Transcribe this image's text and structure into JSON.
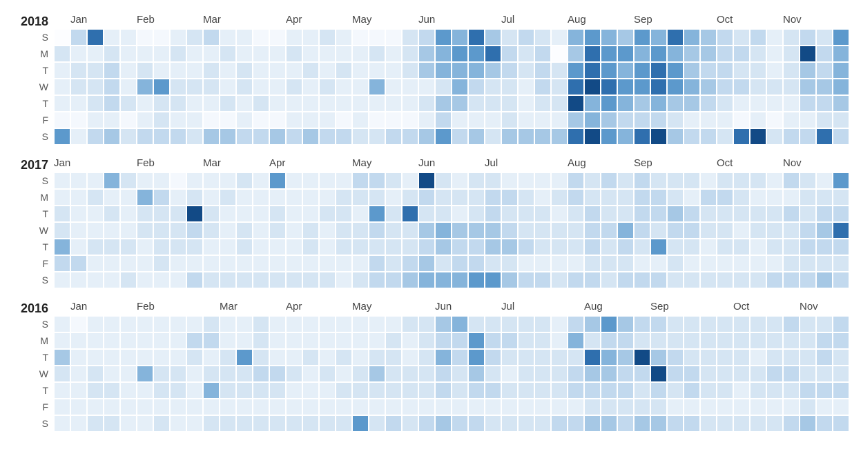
{
  "chart_data": [
    {
      "type": "heatmap",
      "year": "2018",
      "dow_labels": [
        "S",
        "M",
        "T",
        "W",
        "T",
        "F",
        "S"
      ],
      "month_labels": [
        "Jan",
        "Feb",
        "Mar",
        "Apr",
        "May",
        "Jun",
        "Jul",
        "Aug",
        "Sep",
        "Oct",
        "Nov"
      ],
      "month_week_index": [
        1,
        5,
        9,
        14,
        18,
        22,
        27,
        31,
        35,
        40,
        44
      ],
      "color_scale": [
        "#fcfdff",
        "#f4f8fd",
        "#e5eff8",
        "#d5e5f3",
        "#c2d9ee",
        "#a6c8e5",
        "#85b4db",
        "#5c99cc",
        "#2f6fae",
        "#124a86"
      ],
      "weeks": 48,
      "grid": [
        [
          0,
          4,
          8,
          2,
          2,
          1,
          1,
          2,
          3,
          4,
          2,
          2,
          1,
          1,
          2,
          2,
          3,
          2,
          1,
          1,
          1,
          3,
          4,
          7,
          6,
          8,
          5,
          3,
          4,
          3,
          2,
          6,
          7,
          6,
          5,
          7,
          6,
          8,
          6,
          5,
          4,
          3,
          4,
          2,
          3,
          4,
          3,
          7
        ],
        [
          3,
          2,
          2,
          3,
          2,
          2,
          2,
          3,
          2,
          2,
          3,
          2,
          2,
          2,
          3,
          2,
          2,
          2,
          2,
          3,
          2,
          3,
          5,
          6,
          7,
          7,
          8,
          4,
          3,
          4,
          0,
          5,
          8,
          7,
          7,
          6,
          7,
          6,
          5,
          5,
          4,
          4,
          3,
          2,
          3,
          9,
          4,
          6
        ],
        [
          2,
          3,
          3,
          4,
          2,
          3,
          2,
          2,
          2,
          3,
          2,
          3,
          2,
          2,
          2,
          3,
          2,
          3,
          2,
          2,
          2,
          3,
          5,
          6,
          6,
          6,
          5,
          4,
          3,
          4,
          3,
          7,
          8,
          7,
          6,
          7,
          8,
          7,
          5,
          4,
          4,
          3,
          3,
          2,
          3,
          5,
          4,
          6
        ],
        [
          2,
          3,
          3,
          4,
          2,
          6,
          7,
          3,
          3,
          3,
          2,
          3,
          2,
          2,
          3,
          2,
          3,
          2,
          2,
          6,
          2,
          2,
          2,
          3,
          6,
          4,
          3,
          3,
          2,
          4,
          3,
          8,
          9,
          8,
          7,
          7,
          8,
          7,
          6,
          5,
          4,
          4,
          3,
          3,
          3,
          5,
          5,
          6
        ],
        [
          2,
          2,
          3,
          4,
          3,
          2,
          3,
          3,
          2,
          2,
          3,
          2,
          3,
          2,
          2,
          2,
          2,
          2,
          2,
          2,
          2,
          2,
          3,
          5,
          5,
          3,
          3,
          3,
          2,
          3,
          3,
          9,
          6,
          7,
          6,
          5,
          6,
          5,
          5,
          4,
          3,
          2,
          2,
          2,
          2,
          4,
          4,
          5
        ],
        [
          1,
          1,
          2,
          2,
          1,
          2,
          3,
          2,
          2,
          1,
          1,
          2,
          1,
          1,
          2,
          2,
          2,
          1,
          2,
          1,
          1,
          1,
          2,
          4,
          2,
          2,
          2,
          3,
          2,
          2,
          2,
          5,
          6,
          5,
          4,
          4,
          4,
          3,
          2,
          2,
          2,
          1,
          2,
          1,
          2,
          2,
          3,
          3
        ],
        [
          7,
          2,
          4,
          5,
          3,
          4,
          4,
          4,
          3,
          5,
          5,
          4,
          4,
          5,
          4,
          5,
          4,
          4,
          3,
          3,
          4,
          4,
          5,
          7,
          4,
          5,
          3,
          5,
          5,
          5,
          5,
          8,
          9,
          7,
          6,
          8,
          9,
          5,
          4,
          4,
          3,
          8,
          9,
          3,
          4,
          4,
          8,
          4
        ]
      ]
    },
    {
      "type": "heatmap",
      "year": "2017",
      "dow_labels": [
        "S",
        "M",
        "T",
        "W",
        "T",
        "F",
        "S"
      ],
      "month_labels": [
        "Jan",
        "Feb",
        "Mar",
        "Apr",
        "May",
        "Jun",
        "Jul",
        "Aug",
        "Sep",
        "Oct",
        "Nov"
      ],
      "month_week_index": [
        0,
        5,
        9,
        13,
        18,
        22,
        26,
        31,
        35,
        40,
        44
      ],
      "color_scale": [
        "#fcfdff",
        "#f4f8fd",
        "#e5eff8",
        "#d5e5f3",
        "#c2d9ee",
        "#a6c8e5",
        "#85b4db",
        "#5c99cc",
        "#2f6fae",
        "#124a86"
      ],
      "weeks": 48,
      "grid": [
        [
          2,
          2,
          2,
          6,
          3,
          2,
          2,
          1,
          2,
          2,
          2,
          3,
          2,
          7,
          2,
          2,
          2,
          2,
          4,
          4,
          3,
          2,
          9,
          3,
          2,
          3,
          3,
          2,
          2,
          2,
          2,
          4,
          3,
          4,
          3,
          4,
          3,
          3,
          3,
          2,
          3,
          3,
          3,
          2,
          4,
          3,
          2,
          7
        ],
        [
          2,
          2,
          3,
          2,
          2,
          6,
          4,
          2,
          3,
          2,
          3,
          2,
          2,
          2,
          2,
          2,
          2,
          3,
          3,
          3,
          2,
          3,
          4,
          3,
          3,
          3,
          4,
          4,
          3,
          2,
          3,
          4,
          3,
          3,
          3,
          4,
          4,
          3,
          2,
          4,
          4,
          3,
          2,
          2,
          2,
          3,
          3,
          3
        ],
        [
          3,
          2,
          2,
          3,
          2,
          3,
          3,
          3,
          9,
          3,
          2,
          2,
          2,
          3,
          2,
          2,
          3,
          3,
          2,
          7,
          3,
          8,
          3,
          3,
          2,
          3,
          4,
          3,
          3,
          3,
          2,
          3,
          4,
          3,
          3,
          4,
          4,
          5,
          4,
          3,
          3,
          3,
          3,
          3,
          4,
          3,
          4,
          4
        ],
        [
          3,
          2,
          2,
          2,
          2,
          3,
          3,
          3,
          4,
          3,
          2,
          3,
          2,
          3,
          2,
          3,
          2,
          3,
          3,
          4,
          3,
          3,
          5,
          6,
          5,
          5,
          5,
          4,
          3,
          3,
          3,
          3,
          4,
          4,
          6,
          4,
          3,
          4,
          4,
          3,
          3,
          2,
          3,
          3,
          3,
          4,
          5,
          8
        ],
        [
          6,
          2,
          3,
          3,
          3,
          2,
          3,
          3,
          3,
          2,
          2,
          3,
          2,
          2,
          2,
          3,
          2,
          3,
          3,
          3,
          3,
          3,
          4,
          5,
          4,
          4,
          5,
          5,
          4,
          3,
          3,
          3,
          4,
          3,
          4,
          3,
          7,
          3,
          3,
          2,
          3,
          3,
          2,
          3,
          3,
          4,
          4,
          4
        ],
        [
          4,
          4,
          2,
          2,
          2,
          2,
          3,
          2,
          2,
          2,
          2,
          2,
          2,
          2,
          2,
          2,
          2,
          2,
          2,
          4,
          3,
          4,
          5,
          3,
          4,
          4,
          3,
          3,
          2,
          2,
          2,
          2,
          3,
          3,
          3,
          2,
          2,
          3,
          2,
          2,
          2,
          2,
          2,
          2,
          3,
          3,
          3,
          3
        ],
        [
          2,
          2,
          2,
          2,
          3,
          2,
          2,
          2,
          4,
          3,
          3,
          3,
          3,
          3,
          3,
          3,
          3,
          2,
          3,
          4,
          4,
          5,
          6,
          6,
          6,
          7,
          7,
          5,
          4,
          4,
          3,
          4,
          4,
          3,
          4,
          4,
          4,
          3,
          3,
          3,
          3,
          3,
          3,
          4,
          4,
          4,
          5,
          4
        ]
      ]
    },
    {
      "type": "heatmap",
      "year": "2016",
      "dow_labels": [
        "S",
        "M",
        "T",
        "W",
        "T",
        "F",
        "S"
      ],
      "month_labels": [
        "Jan",
        "Feb",
        "Mar",
        "Apr",
        "May",
        "Jun",
        "Jul",
        "Aug",
        "Sep",
        "Oct",
        "Nov"
      ],
      "month_week_index": [
        1,
        5,
        10,
        14,
        18,
        23,
        27,
        32,
        36,
        41,
        45
      ],
      "color_scale": [
        "#fcfdff",
        "#f4f8fd",
        "#e5eff8",
        "#d5e5f3",
        "#c2d9ee",
        "#a6c8e5",
        "#85b4db",
        "#5c99cc",
        "#2f6fae",
        "#124a86"
      ],
      "weeks": 48,
      "grid": [
        [
          2,
          1,
          2,
          2,
          2,
          2,
          2,
          2,
          2,
          3,
          2,
          2,
          3,
          2,
          2,
          2,
          2,
          2,
          2,
          2,
          2,
          3,
          3,
          5,
          6,
          3,
          3,
          3,
          3,
          3,
          2,
          4,
          5,
          7,
          5,
          4,
          4,
          3,
          3,
          3,
          3,
          3,
          3,
          3,
          4,
          3,
          3,
          4
        ],
        [
          2,
          2,
          2,
          2,
          2,
          2,
          2,
          2,
          4,
          4,
          2,
          2,
          3,
          2,
          2,
          2,
          2,
          2,
          2,
          2,
          3,
          2,
          3,
          4,
          4,
          7,
          4,
          4,
          3,
          3,
          2,
          6,
          3,
          4,
          4,
          3,
          3,
          3,
          3,
          3,
          3,
          3,
          3,
          3,
          3,
          3,
          4,
          4
        ],
        [
          5,
          2,
          2,
          2,
          2,
          2,
          2,
          2,
          3,
          2,
          3,
          7,
          3,
          2,
          2,
          3,
          2,
          3,
          2,
          3,
          3,
          2,
          3,
          6,
          4,
          7,
          4,
          3,
          3,
          3,
          3,
          3,
          8,
          6,
          5,
          9,
          5,
          4,
          3,
          3,
          3,
          3,
          2,
          3,
          3,
          3,
          4,
          3
        ],
        [
          3,
          2,
          3,
          2,
          2,
          6,
          3,
          3,
          2,
          3,
          3,
          3,
          4,
          4,
          3,
          2,
          3,
          2,
          3,
          5,
          3,
          3,
          3,
          4,
          3,
          5,
          3,
          2,
          3,
          3,
          3,
          4,
          5,
          5,
          4,
          4,
          9,
          4,
          4,
          3,
          3,
          3,
          3,
          4,
          4,
          3,
          3,
          3
        ],
        [
          2,
          2,
          3,
          3,
          2,
          2,
          3,
          3,
          2,
          6,
          3,
          3,
          3,
          3,
          2,
          2,
          2,
          3,
          3,
          3,
          3,
          3,
          3,
          4,
          3,
          4,
          4,
          3,
          3,
          3,
          3,
          4,
          4,
          4,
          4,
          3,
          4,
          3,
          4,
          3,
          3,
          2,
          3,
          3,
          3,
          4,
          4,
          4
        ],
        [
          2,
          2,
          2,
          2,
          2,
          2,
          2,
          2,
          2,
          2,
          2,
          2,
          2,
          2,
          2,
          2,
          2,
          2,
          2,
          2,
          2,
          2,
          2,
          2,
          2,
          2,
          2,
          2,
          2,
          2,
          2,
          2,
          3,
          3,
          3,
          3,
          3,
          2,
          2,
          2,
          2,
          2,
          2,
          2,
          2,
          3,
          2,
          2
        ],
        [
          2,
          2,
          3,
          3,
          2,
          2,
          3,
          2,
          2,
          3,
          3,
          3,
          3,
          3,
          3,
          3,
          3,
          3,
          7,
          3,
          4,
          3,
          4,
          5,
          4,
          4,
          3,
          3,
          3,
          3,
          4,
          4,
          5,
          5,
          4,
          5,
          5,
          4,
          4,
          3,
          3,
          3,
          3,
          3,
          4,
          5,
          4,
          4
        ]
      ]
    }
  ]
}
